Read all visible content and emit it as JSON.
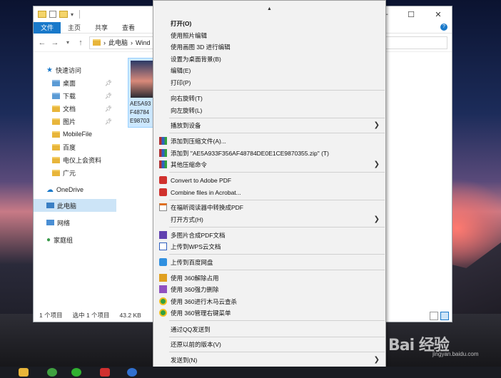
{
  "explorer": {
    "ribbon_tabs": [
      "文件",
      "主页",
      "共享",
      "查看"
    ],
    "address": {
      "path_root": "此电脑",
      "path_next": "Wind"
    },
    "sidebar": {
      "quick_access": "快速访问",
      "items": [
        {
          "label": "桌面",
          "pinned": true
        },
        {
          "label": "下载",
          "pinned": true
        },
        {
          "label": "文档",
          "pinned": true
        },
        {
          "label": "图片",
          "pinned": true
        },
        {
          "label": "MobileFile",
          "pinned": false
        },
        {
          "label": "百度",
          "pinned": false
        },
        {
          "label": "电仪上会资料",
          "pinned": false
        },
        {
          "label": "广元",
          "pinned": false
        }
      ],
      "onedrive": "OneDrive",
      "this_pc": "此电脑",
      "network": "网络",
      "homegroup": "家庭组"
    },
    "file": {
      "name_line1": "AE5A93",
      "name_line2": "F48784",
      "name_line3": "E98703"
    },
    "status": {
      "count": "1 个项目",
      "selected": "选中 1 个项目",
      "size": "43.2 KB"
    },
    "caption": {
      "minimize": "—",
      "maximize": "☐",
      "close": "✕"
    }
  },
  "context_menu": {
    "items": [
      {
        "label": "打开(O)",
        "bold": true
      },
      {
        "label": "使用照片编辑"
      },
      {
        "label": "使用画图 3D 进行编辑"
      },
      {
        "label": "设置为桌面背景(B)"
      },
      {
        "label": "编辑(E)"
      },
      {
        "label": "打印(P)"
      },
      {
        "label": "向右旋转(T)"
      },
      {
        "label": "向左旋转(L)"
      },
      {
        "label": "播放到设备",
        "submenu": true
      },
      {
        "label": "添加到压缩文件(A)..."
      },
      {
        "label": "添加到 \"AE5A933F356AF48784DE0E1CE9870355.zip\" (T)"
      },
      {
        "label": "其他压缩命令",
        "submenu": true
      },
      {
        "label": "Convert to Adobe PDF"
      },
      {
        "label": "Combine files in Acrobat..."
      },
      {
        "label": "在福昕阅读器中转换成PDF"
      },
      {
        "label": "打开方式(H)",
        "submenu": true
      },
      {
        "label": "多图片合成PDF文档"
      },
      {
        "label": "上传到WPS云文档"
      },
      {
        "label": "上传到百度网盘"
      },
      {
        "label": "使用 360解除占用"
      },
      {
        "label": "使用 360强力删除"
      },
      {
        "label": "使用 360进行木马云查杀"
      },
      {
        "label": "使用 360管理右键菜单"
      },
      {
        "label": "通过QQ发送到"
      },
      {
        "label": "还原以前的版本(V)"
      },
      {
        "label": "发送到(N)",
        "submenu": true
      }
    ],
    "scroll_up": "▲",
    "scroll_down": "▼",
    "submenu_arrow": "❯"
  },
  "watermark": {
    "logo": "Bai 经验",
    "url": "jingyan.baidu.com"
  },
  "colors": {
    "accent": "#1979ca",
    "menu_bg": "#f2f2f2",
    "selection": "#cce4f7"
  }
}
